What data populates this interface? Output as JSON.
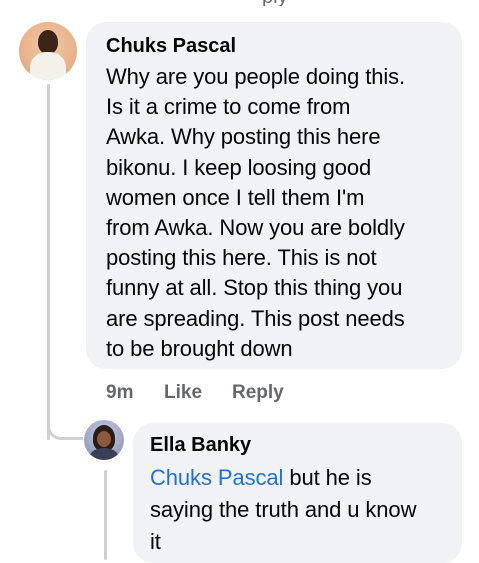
{
  "comments": [
    {
      "author": "Chuks Pascal",
      "lines": [
        "Why are you people doing this.",
        "Is it a crime to come from",
        "Awka. Why posting this here",
        "bikonu. I keep loosing good",
        "women once I tell them I'm",
        "from Awka. Now you are boldly",
        "posting this here. This is not",
        "funny at all. Stop this thing you",
        "are spreading. This post needs",
        "to be brought down"
      ],
      "timestamp": "9m",
      "like_label": "Like",
      "reply_label": "Reply"
    }
  ],
  "reply": {
    "author": "Ella Banky",
    "mention": "Chuks Pascal",
    "line1_rest": " but he is",
    "line2": "saying the truth and u know",
    "line3": "it"
  },
  "colors": {
    "bubble": "#f0f2f5",
    "mention": "#216fdb",
    "meta": "#65676b",
    "thread_line": "#ced0d4"
  }
}
